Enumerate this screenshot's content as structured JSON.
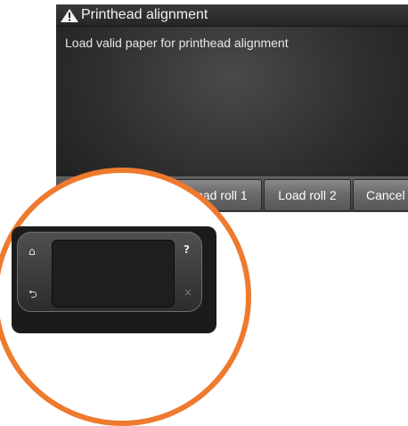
{
  "screen": {
    "title": "Printhead alignment",
    "message": "Load valid paper for printhead alignment",
    "buttons": {
      "load_roll_1": "Load roll 1",
      "load_roll_2": "Load roll 2",
      "cancel": "Cancel"
    },
    "icons": {
      "title": "warning-icon"
    }
  },
  "device_panel": {
    "icons": {
      "home": "⌂",
      "back": "⮌",
      "help": "?",
      "close": "×"
    }
  },
  "colors": {
    "ring": "#ee7a2e",
    "screen_bg": "#2e2e2e",
    "button": "#6a6a6a"
  }
}
